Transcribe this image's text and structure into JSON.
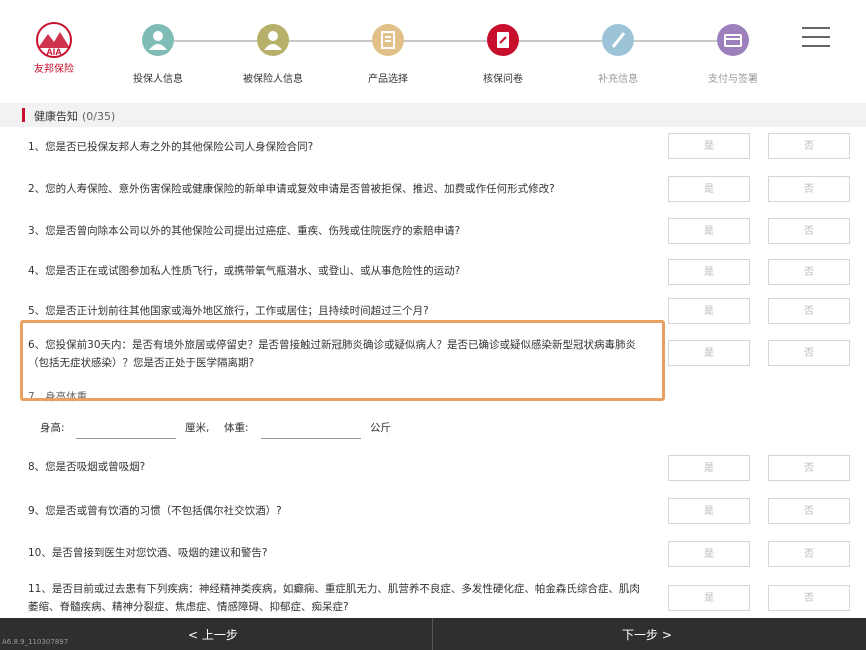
{
  "logo": {
    "mark_text": "AIA",
    "name": "友邦保险"
  },
  "steps": [
    {
      "label": "投保人信息",
      "color": "#7fbcb5"
    },
    {
      "label": "被保险人信息",
      "color": "#b6b06a"
    },
    {
      "label": "产品选择",
      "color": "#e2c08a"
    },
    {
      "label": "核保问卷",
      "color": "#c8102e"
    },
    {
      "label": "补充信息",
      "color": "#9cc4d6"
    },
    {
      "label": "支付与签署",
      "color": "#9c7fbb"
    }
  ],
  "section": {
    "title": "健康告知",
    "count": "(0/35)"
  },
  "answers": {
    "yes": "是",
    "no": "否"
  },
  "questions": [
    {
      "text": "1、您是否已投保友邦人寿之外的其他保险公司人身保险合同?"
    },
    {
      "text": "2、您的人寿保险、意外伤害保险或健康保险的新单申请或复效申请是否曾被拒保、推迟、加费或作任何形式修改?"
    },
    {
      "text": "3、您是否曾向除本公司以外的其他保险公司提出过癌症、重疾、伤残或住院医疗的索赔申请?"
    },
    {
      "text": "4、您是否正在或试图参加私人性质飞行，或携带氧气瓶潜水、或登山、或从事危险性的运动?"
    },
    {
      "text": "5、您是否正计划前往其他国家或海外地区旅行，工作或居住；且持续时间超过三个月?"
    },
    {
      "text": "6、您投保前30天内：是否有境外旅居或停留史？是否曾接触过新冠肺炎确诊或疑似病人？是否已确诊或疑似感染新型冠状病毒肺炎（包括无症状感染）？您是否正处于医学隔离期?"
    },
    {
      "text": "7、身高体重"
    },
    {
      "text": "8、您是否吸烟或曾吸烟?"
    },
    {
      "text": "9、您是否或曾有饮酒的习惯（不包括偶尔社交饮酒）?"
    },
    {
      "text": "10、是否曾接到医生对您饮酒、吸烟的建议和警告?"
    },
    {
      "text": "11、是否目前或过去患有下列疾病：神经精神类疾病，如癫痫、重症肌无力、肌营养不良症、多发性硬化症、帕金森氏综合症、肌肉萎缩、脊髓疾病、精神分裂症、焦虑症、情感障碍、抑郁症、痴呆症?"
    }
  ],
  "height_weight": {
    "height_label": "身高:",
    "height_unit": "厘米,",
    "weight_label": "体重:",
    "weight_unit": "公斤"
  },
  "footer": {
    "version": "A6.8.9_110307897",
    "prev": "< 上一步",
    "next": "下一步 >"
  },
  "colors": {
    "accent": "#c8102e",
    "highlight": "#e9a060",
    "footer_bg": "#2f2f2f"
  }
}
